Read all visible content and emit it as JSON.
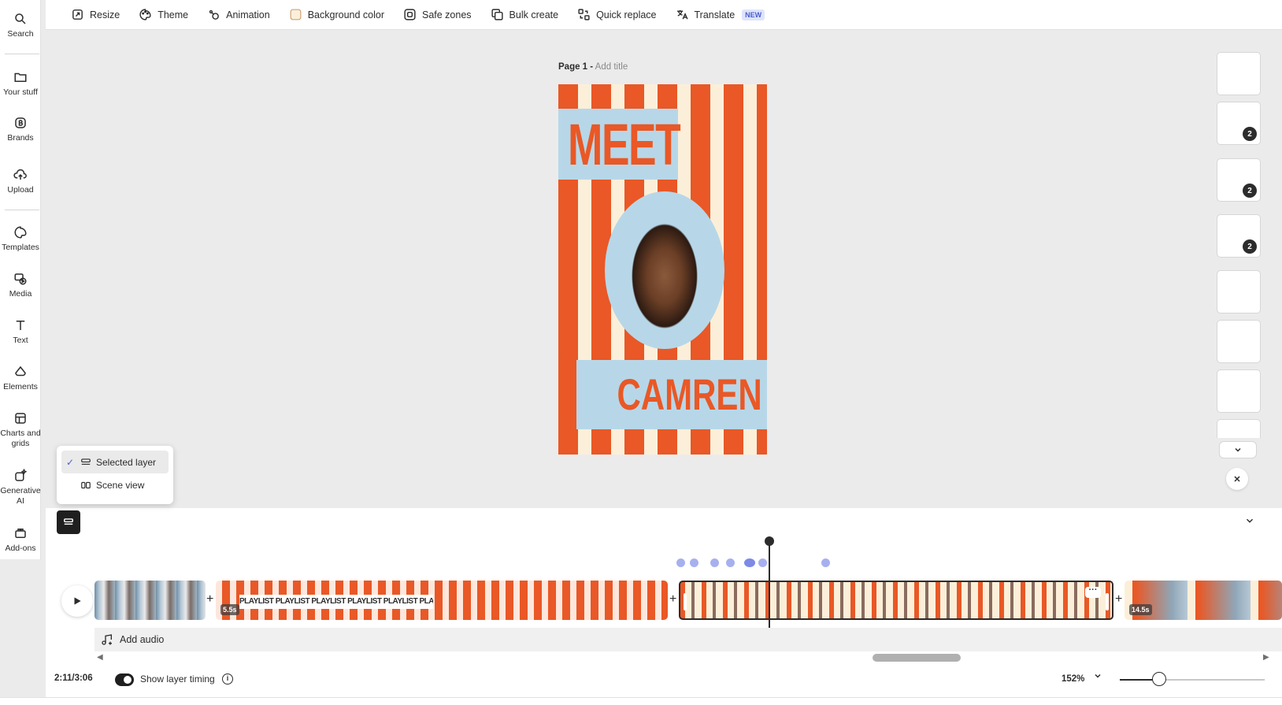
{
  "toolbar": {
    "resize": "Resize",
    "theme": "Theme",
    "animation": "Animation",
    "background_color": "Background color",
    "safe_zones": "Safe zones",
    "bulk_create": "Bulk create",
    "quick_replace": "Quick replace",
    "translate": "Translate",
    "translate_badge": "NEW"
  },
  "rail": {
    "search": "Search",
    "your_stuff": "Your stuff",
    "brands": "Brands",
    "upload": "Upload",
    "templates": "Templates",
    "media": "Media",
    "text": "Text",
    "elements": "Elements",
    "charts_and_grids": "Charts and grids",
    "generative_ai": "Generative AI",
    "add_ons": "Add-ons"
  },
  "canvas": {
    "page_label": "Page 1 -",
    "add_title": "Add title",
    "headline_top": "MEET",
    "headline_bottom": "CAMREN",
    "colors": {
      "orange": "#e95826",
      "cream": "#fcefd9",
      "light_blue": "#b7d7e8"
    }
  },
  "thumbnails": {
    "badges": [
      "2",
      "2",
      "2"
    ]
  },
  "view_popover": {
    "selected_layer": "Selected layer",
    "scene_view": "Scene view",
    "selected": "Selected layer"
  },
  "timeline": {
    "clips": [
      {
        "duration": ""
      },
      {
        "duration": "5.5s",
        "text": "PLAYLIST PLAYLIST PLAYLIST PLAYLIST PLAYLIST PLAYLIST PLAYLIST"
      },
      {
        "duration": ""
      },
      {
        "duration": "14.5s"
      }
    ],
    "add_audio": "Add audio",
    "time": "2:11/3:06",
    "show_layer_timing": "Show layer timing",
    "show_layer_timing_on": true,
    "zoom": "152%",
    "zoom_level": 0.27
  },
  "icons": [
    "search-icon",
    "folder-icon",
    "brand-icon",
    "upload-icon",
    "templates-icon",
    "media-icon",
    "text-icon",
    "elements-icon",
    "charts-icon",
    "generative-ai-icon",
    "add-ons-icon",
    "play-icon",
    "audio-icon",
    "info-icon",
    "chevron-down-icon",
    "close-icon"
  ]
}
